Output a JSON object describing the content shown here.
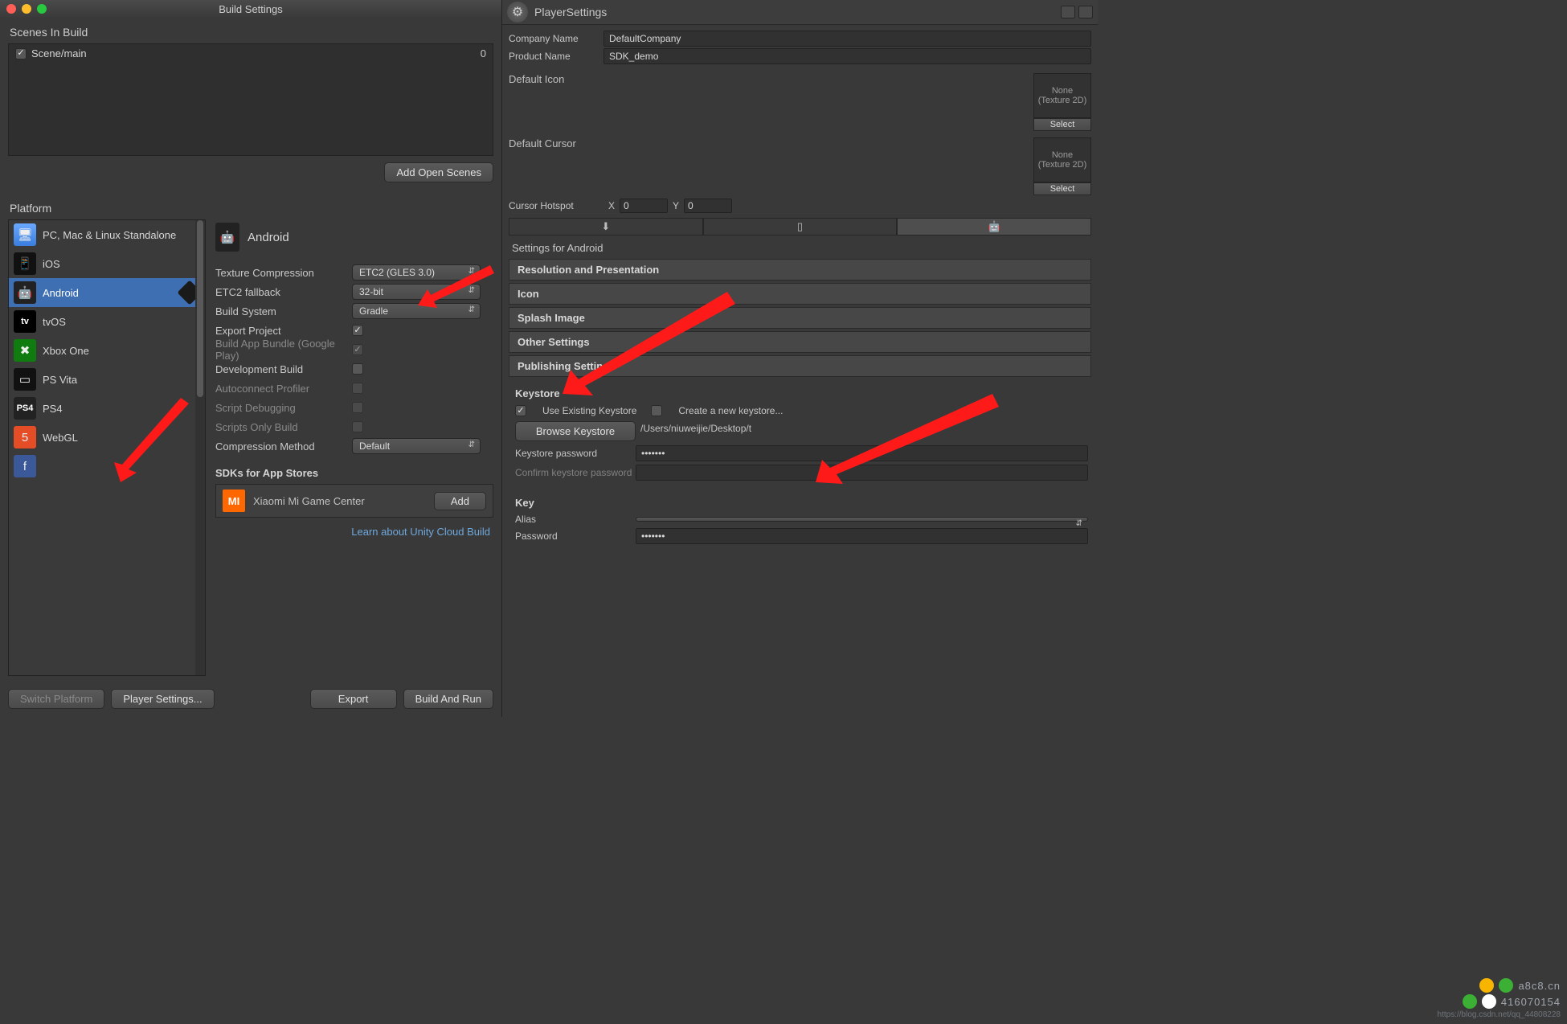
{
  "window": {
    "title": "Build Settings"
  },
  "scenes": {
    "header": "Scenes In Build",
    "items": [
      {
        "name": "Scene/main",
        "index": "0",
        "checked": true
      }
    ],
    "add_button": "Add Open Scenes"
  },
  "platform": {
    "header": "Platform",
    "items": [
      {
        "key": "standalone",
        "label": "PC, Mac & Linux Standalone"
      },
      {
        "key": "ios",
        "label": "iOS"
      },
      {
        "key": "android",
        "label": "Android",
        "selected": true
      },
      {
        "key": "tvos",
        "label": "tvOS"
      },
      {
        "key": "xboxone",
        "label": "Xbox One"
      },
      {
        "key": "psvita",
        "label": "PS Vita"
      },
      {
        "key": "ps4",
        "label": "PS4"
      },
      {
        "key": "webgl",
        "label": "WebGL"
      },
      {
        "key": "facebook",
        "label": ""
      }
    ],
    "detail": {
      "title": "Android",
      "rows": {
        "tex_comp": {
          "label": "Texture Compression",
          "value": "ETC2 (GLES 3.0)"
        },
        "etc2": {
          "label": "ETC2 fallback",
          "value": "32-bit"
        },
        "build_sys": {
          "label": "Build System",
          "value": "Gradle"
        },
        "export_proj": {
          "label": "Export Project",
          "checked": true
        },
        "app_bundle": {
          "label": "Build App Bundle (Google Play)",
          "checked": true,
          "disabled": true
        },
        "dev_build": {
          "label": "Development Build",
          "checked": false
        },
        "autoconnect": {
          "label": "Autoconnect Profiler",
          "checked": false,
          "disabled": true
        },
        "script_dbg": {
          "label": "Script Debugging",
          "checked": false,
          "disabled": true
        },
        "scripts_only": {
          "label": "Scripts Only Build",
          "checked": false,
          "disabled": true
        },
        "comp_method": {
          "label": "Compression Method",
          "value": "Default"
        }
      },
      "sdks": {
        "title": "SDKs for App Stores",
        "mi": "Xiaomi Mi Game Center",
        "add": "Add"
      },
      "cloud_link": "Learn about Unity Cloud Build"
    }
  },
  "buttons": {
    "switch": "Switch Platform",
    "player_settings": "Player Settings...",
    "export": "Export",
    "build_run": "Build And Run"
  },
  "inspector": {
    "title": "PlayerSettings",
    "company": {
      "label": "Company Name",
      "value": "DefaultCompany"
    },
    "product": {
      "label": "Product Name",
      "value": "SDK_demo"
    },
    "default_icon": {
      "label": "Default Icon",
      "none": "None",
      "type": "(Texture 2D)",
      "select": "Select"
    },
    "default_cursor": {
      "label": "Default Cursor",
      "none": "None",
      "type": "(Texture 2D)",
      "select": "Select"
    },
    "hotspot": {
      "label": "Cursor Hotspot",
      "x_label": "X",
      "x": "0",
      "y_label": "Y",
      "y": "0"
    },
    "settings_for": "Settings for Android",
    "sections": {
      "resolution": "Resolution and Presentation",
      "icon": "Icon",
      "splash": "Splash Image",
      "other": "Other Settings",
      "publishing": "Publishing Settings"
    },
    "keystore": {
      "header": "Keystore",
      "use_existing": "Use Existing Keystore",
      "create_new": "Create a new keystore...",
      "browse": "Browse Keystore",
      "path": "/Users/niuweijie/Desktop/t",
      "pw_label": "Keystore password",
      "pw_value": "*******",
      "confirm_label": "Confirm keystore password"
    },
    "key": {
      "header": "Key",
      "alias_label": "Alias",
      "alias_value": "",
      "pw_label": "Password",
      "pw_value": "*******"
    }
  },
  "watermark": {
    "site": "a8c8.cn",
    "num": "416070154",
    "url": "https://blog.csdn.net/qq_44808228"
  }
}
